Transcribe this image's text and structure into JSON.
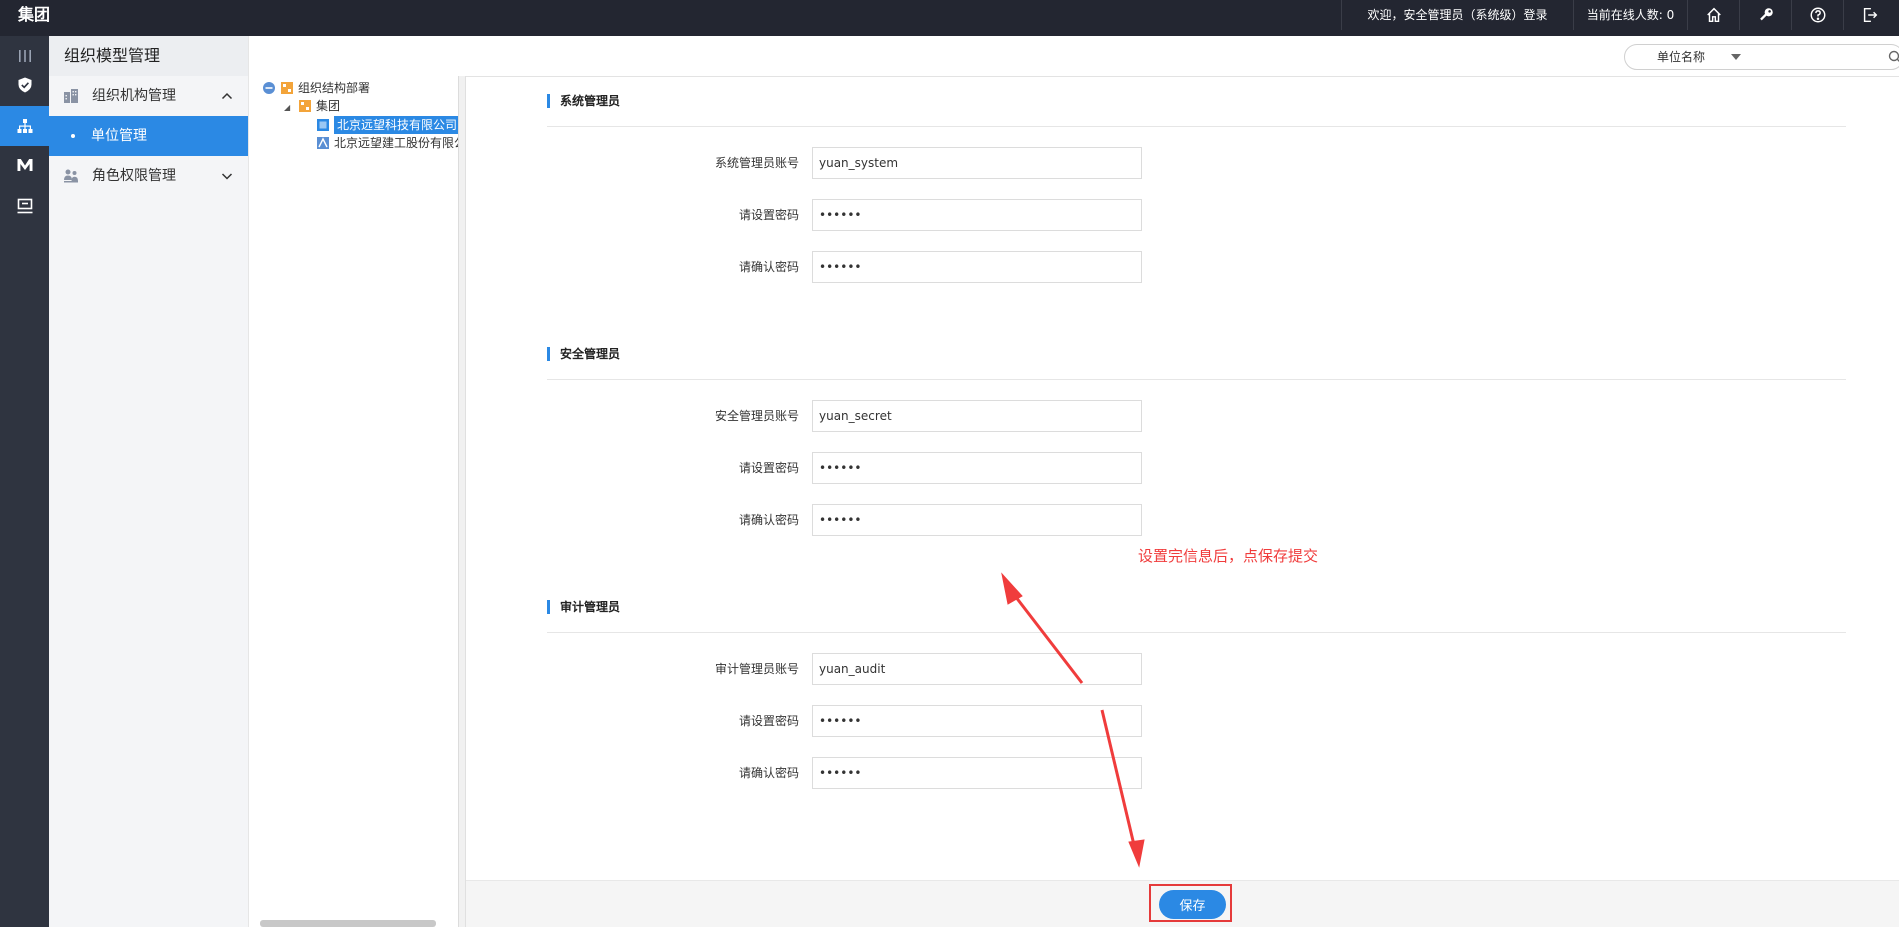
{
  "topbar": {
    "brand": "集团",
    "welcome": "欢迎，安全管理员（系统级）登录",
    "online": "当前在线人数: 0",
    "icons": [
      "home-icon",
      "key-icon",
      "help-icon",
      "logout-icon"
    ]
  },
  "rail": {
    "icons": [
      "menu-icon",
      "shield-icon",
      "org-tree-icon",
      "m-logo-icon",
      "monitor-icon"
    ],
    "active_index": 2
  },
  "sidemenu": {
    "title": "组织模型管理",
    "groups": [
      {
        "label": "组织机构管理",
        "expanded": true,
        "icon": "building-icon"
      },
      {
        "label": "角色权限管理",
        "expanded": false,
        "icon": "role-icon"
      }
    ],
    "active_sub": "单位管理"
  },
  "tree": {
    "nodes": [
      {
        "label": "组织结构部署",
        "level": 0
      },
      {
        "label": "集团",
        "level": 1
      },
      {
        "label": "北京远望科技有限公司",
        "level": 2,
        "selected": true
      },
      {
        "label": "北京远望建工股份有限公",
        "level": 2
      }
    ]
  },
  "search": {
    "field_label": "单位名称",
    "placeholder": ""
  },
  "sections": [
    {
      "title": "系统管理员",
      "fields": [
        {
          "label": "系统管理员账号",
          "value": "yuan_system",
          "type": "text"
        },
        {
          "label": "请设置密码",
          "value": "••••••",
          "type": "password"
        },
        {
          "label": "请确认密码",
          "value": "••••••",
          "type": "password"
        }
      ]
    },
    {
      "title": "安全管理员",
      "fields": [
        {
          "label": "安全管理员账号",
          "value": "yuan_secret",
          "type": "text"
        },
        {
          "label": "请设置密码",
          "value": "••••••",
          "type": "password"
        },
        {
          "label": "请确认密码",
          "value": "••••••",
          "type": "password"
        }
      ]
    },
    {
      "title": "审计管理员",
      "fields": [
        {
          "label": "审计管理员账号",
          "value": "yuan_audit",
          "type": "text"
        },
        {
          "label": "请设置密码",
          "value": "••••••",
          "type": "password"
        },
        {
          "label": "请确认密码",
          "value": "••••••",
          "type": "password"
        }
      ]
    }
  ],
  "annotation": "设置完信息后，点保存提交",
  "footer": {
    "save_label": "保存"
  },
  "colors": {
    "accent": "#2b89e4",
    "topbar": "#232631",
    "rail": "#2f3440",
    "annotation": "#f03c3c"
  }
}
